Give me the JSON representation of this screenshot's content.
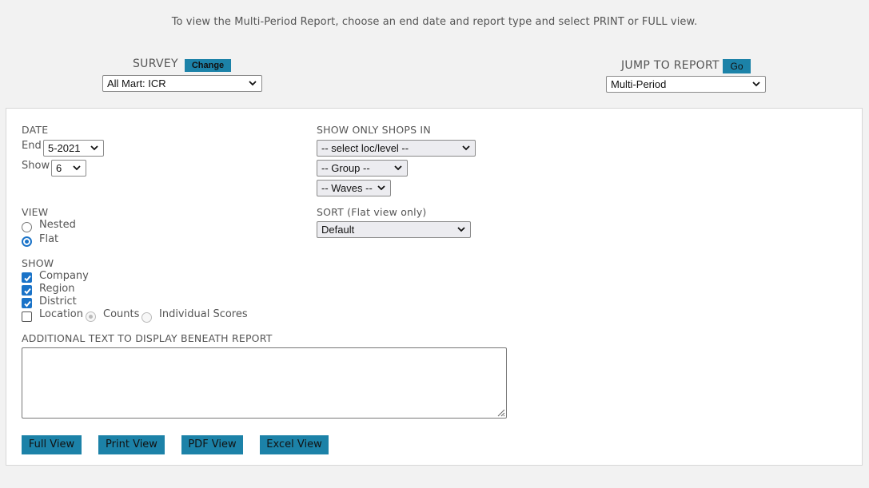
{
  "intro_text": "To view the Multi-Period Report, choose an end date and report type and select PRINT or FULL view.",
  "survey": {
    "label": "SURVEY",
    "change_button": "Change",
    "selected": "All Mart: ICR"
  },
  "jump": {
    "label": "JUMP TO REPORT",
    "go_button": "Go",
    "selected": "Multi-Period"
  },
  "date": {
    "label": "DATE",
    "end_label": "End",
    "end_value": "5-2021",
    "show_label": "Show",
    "show_value": "6"
  },
  "filters": {
    "label": "SHOW ONLY SHOPS IN",
    "loc_level": "-- select loc/level --",
    "group": "-- Group --",
    "waves": "-- Waves --"
  },
  "view": {
    "label": "VIEW",
    "options": [
      {
        "label": "Nested",
        "selected": false
      },
      {
        "label": "Flat",
        "selected": true
      }
    ]
  },
  "sort": {
    "label": "SORT (Flat view only)",
    "selected": "Default"
  },
  "show": {
    "label": "SHOW",
    "items": [
      {
        "label": "Company",
        "checked": true
      },
      {
        "label": "Region",
        "checked": true
      },
      {
        "label": "District",
        "checked": true
      },
      {
        "label": "Location",
        "checked": false
      }
    ],
    "location_options": [
      {
        "label": "Counts",
        "selected": true,
        "disabled": true
      },
      {
        "label": "Individual Scores",
        "selected": false,
        "disabled": true
      }
    ]
  },
  "additional_text": {
    "label": "ADDITIONAL TEXT TO DISPLAY BENEATH REPORT",
    "value": ""
  },
  "buttons": {
    "full": "Full View",
    "print": "Print View",
    "pdf": "PDF View",
    "excel": "Excel View"
  },
  "colors": {
    "accent": "#1c82a8",
    "control_blue": "#1a73c8",
    "background": "#f2f2f2"
  }
}
